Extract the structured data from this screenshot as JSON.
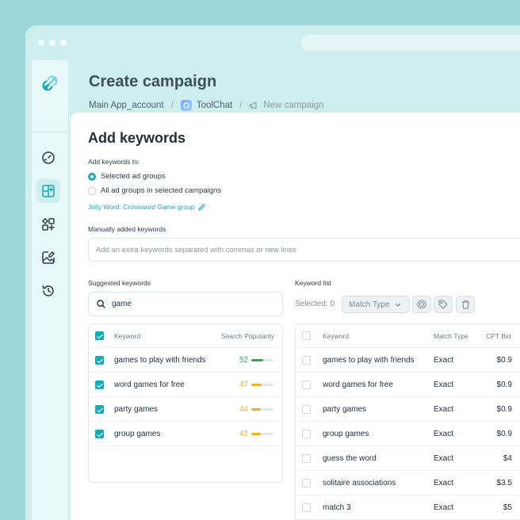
{
  "page": {
    "title": "Create campaign",
    "breadcrumb": {
      "account": "Main App_account",
      "app": "ToolChat",
      "current": "New campaign"
    }
  },
  "sidebar": {
    "items": [
      {
        "icon": "gauge-icon",
        "active": false
      },
      {
        "icon": "dashboard-add-icon",
        "active": true
      },
      {
        "icon": "apps-add-icon",
        "active": false
      },
      {
        "icon": "image-edit-icon",
        "active": false
      },
      {
        "icon": "history-icon",
        "active": false
      }
    ]
  },
  "keywords_panel": {
    "title": "Add keywords",
    "add_to_label": "Add keywords to:",
    "radio_selected_groups": "Selected ad groups",
    "radio_all_groups": "All ad groups in selected campaigns",
    "group_link": "Jolly Word: Crossword Game group",
    "manual_label": "Manually added keywords",
    "manual_placeholder": "Add an extra keywords separated with commas or new lines"
  },
  "suggested": {
    "label": "Suggested keywords",
    "search_value": "game",
    "col_keyword": "Keyword",
    "col_popularity": "Search Popularity",
    "rows": [
      {
        "keyword": "games to play with friends",
        "popularity": 52,
        "color": "#3aa655"
      },
      {
        "keyword": "word games for free",
        "popularity": 47,
        "color": "#f2b31b"
      },
      {
        "keyword": "party games",
        "popularity": 44,
        "color": "#f2b31b"
      },
      {
        "keyword": "group games",
        "popularity": 42,
        "color": "#f2b31b"
      }
    ]
  },
  "keyword_list": {
    "label": "Keyword list",
    "selected": "Selected: 0",
    "match_type_btn": "Match Type",
    "col_keyword": "Keyword",
    "col_match": "Match Type",
    "col_bid": "CPT Bid",
    "rows": [
      {
        "keyword": "games to play with friends",
        "match": "Exact",
        "bid": "$0.9"
      },
      {
        "keyword": "word games for free",
        "match": "Exact",
        "bid": "$0.9"
      },
      {
        "keyword": "party games",
        "match": "Exact",
        "bid": "$0.9"
      },
      {
        "keyword": "group games",
        "match": "Exact",
        "bid": "$0.9"
      },
      {
        "keyword": "guess the word",
        "match": "Exact",
        "bid": "$4"
      },
      {
        "keyword": "solitaire associations",
        "match": "Exact",
        "bid": "$3.5"
      },
      {
        "keyword": "match 3",
        "match": "Exact",
        "bid": "$5"
      }
    ]
  },
  "colors": {
    "accent": "#1aa8b4",
    "background": "#9dd7dc"
  }
}
